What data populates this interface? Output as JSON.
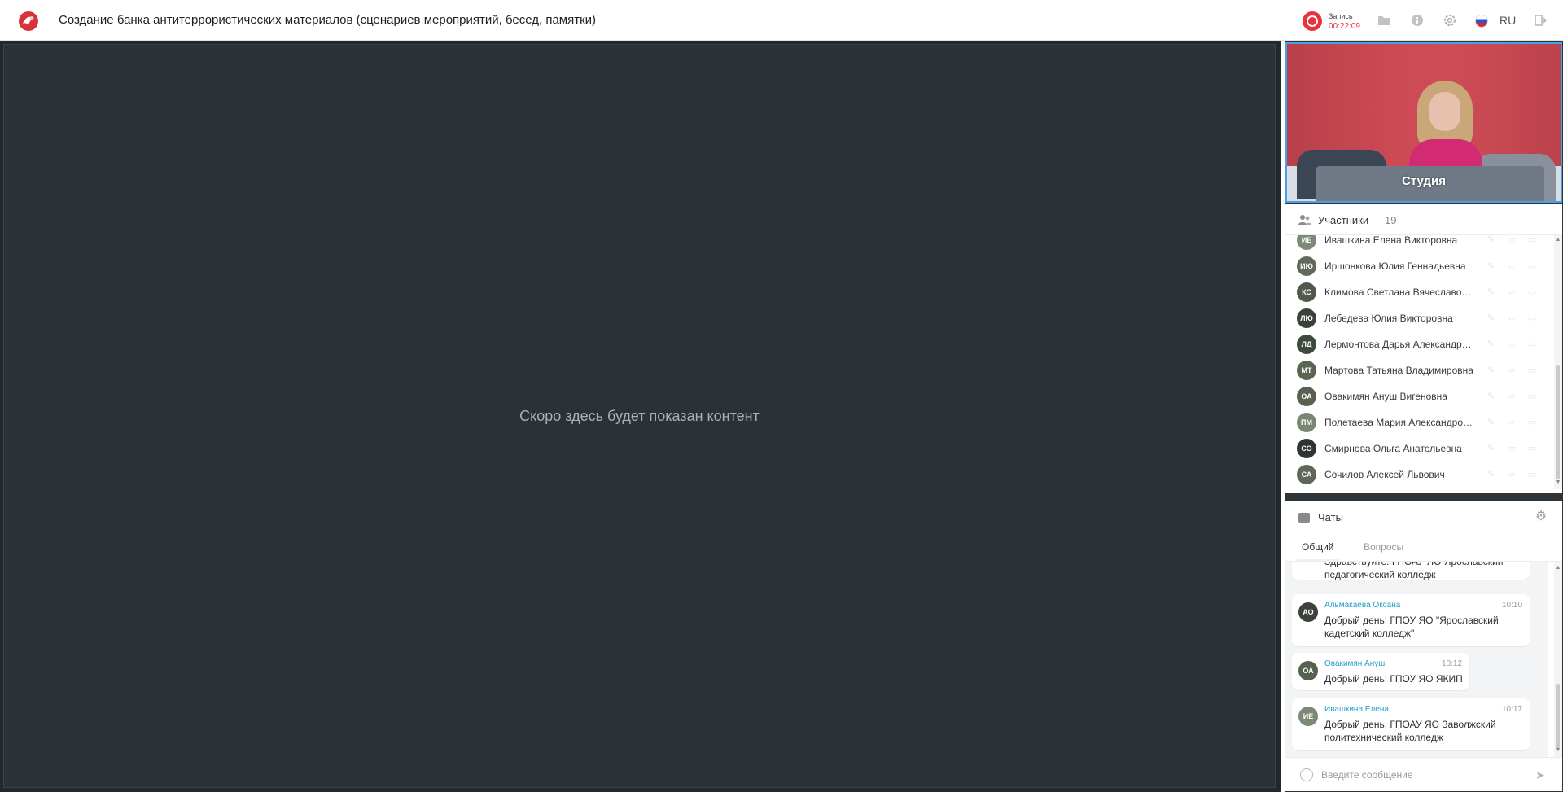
{
  "header": {
    "title": "Создание банка антитеррористических материалов (сценариев мероприятий, бесед, памятки)",
    "recording_label": "Запись",
    "recording_time": "00:22:09",
    "language": "RU"
  },
  "stage": {
    "placeholder": "Скоро здесь будет показан контент"
  },
  "video": {
    "label": "Студия"
  },
  "participants": {
    "title": "Участники",
    "count": "19",
    "items": [
      {
        "initials": "ИЕ",
        "name": "Ивашкина Елена Викторовна",
        "color": "#7c8a75"
      },
      {
        "initials": "ИЮ",
        "name": "Иршонкова Юлия Геннадьевна",
        "color": "#5f6a5a"
      },
      {
        "initials": "КС",
        "name": "Климова Светлана Вячеславовна",
        "color": "#4f5a4d"
      },
      {
        "initials": "ЛЮ",
        "name": "Лебедева Юлия Викторовна",
        "color": "#3b423a"
      },
      {
        "initials": "ЛД",
        "name": "Лермонтова Дарья Александро...",
        "color": "#3f4a3f"
      },
      {
        "initials": "МТ",
        "name": "Мартова Татьяна Владимировна",
        "color": "#5a6552"
      },
      {
        "initials": "ОА",
        "name": "Овакимян Ануш Вигеновна",
        "color": "#56614f"
      },
      {
        "initials": "ПМ",
        "name": "Полетаева Мария Александровна",
        "color": "#7a8574"
      },
      {
        "initials": "СО",
        "name": "Смирнова Ольга Анатольевна",
        "color": "#2f3530"
      },
      {
        "initials": "СА",
        "name": "Сочилов Алексей Львович",
        "color": "#5d6859"
      }
    ]
  },
  "chats": {
    "title": "Чаты",
    "tabs": [
      "Общий",
      "Вопросы"
    ],
    "partial_text": [
      "Здравствуйте. ГПОАУ ЯО Ярославский",
      "педагогический колледж"
    ],
    "messages": [
      {
        "initials": "АО",
        "author": "Альмакаева Оксана",
        "time": "10:10",
        "text1": "Добрый день! ГПОУ ЯО \"Ярославский",
        "text2": "кадетский колледж\"",
        "color": "#3b423a"
      },
      {
        "initials": "ОА",
        "author": "Овакимян Ануш",
        "time": "10:12",
        "text1": "Добрый день! ГПОУ ЯО ЯКИП",
        "text2": "",
        "color": "#56614f"
      },
      {
        "initials": "ИЕ",
        "author": "Ивашкина Елена",
        "time": "10:17",
        "text1": "Добрый день. ГПОАУ ЯО Заволжский",
        "text2": "политехнический колледж",
        "color": "#7c8a75"
      }
    ],
    "input_placeholder": "Введите сообщение"
  },
  "colors": {
    "stage_bg": "#2a3236",
    "accent_blue": "#4aa0e6",
    "record_red": "#e8323c",
    "author_link": "#25a0c8"
  },
  "icons": [
    "app-logo-icon",
    "record-icon",
    "folder-icon",
    "info-icon",
    "settings-icon",
    "russian-flag-icon",
    "exit-icon",
    "people-icon",
    "chat-icon",
    "gear-icon",
    "emoji-icon",
    "send-icon",
    "pencil-icon",
    "chat-bubble-icon",
    "screen-icon"
  ]
}
